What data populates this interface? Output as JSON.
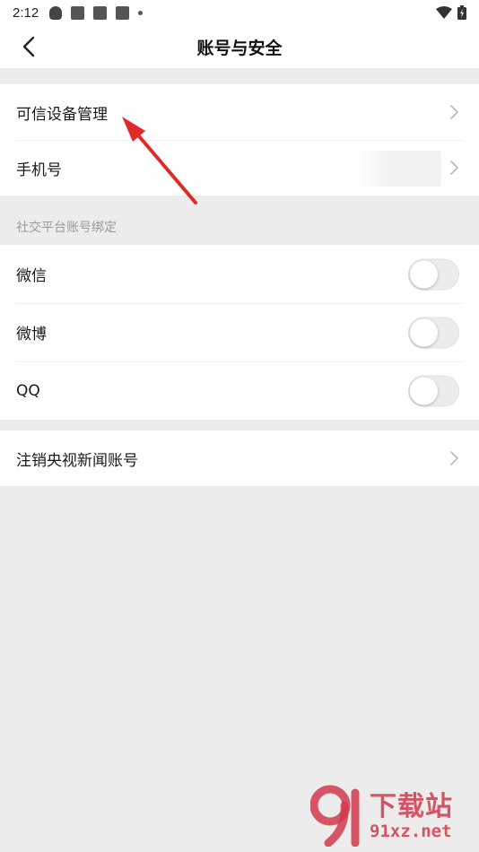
{
  "status_bar": {
    "time": "2:12"
  },
  "header": {
    "title": "账号与安全",
    "back_icon": "chevron-left-icon"
  },
  "account_group": {
    "items": [
      {
        "label": "可信设备管理"
      },
      {
        "label": "手机号"
      }
    ]
  },
  "social_section": {
    "title": "社交平台账号绑定",
    "items": [
      {
        "label": "微信",
        "enabled": false
      },
      {
        "label": "微博",
        "enabled": false
      },
      {
        "label": "QQ",
        "enabled": false
      }
    ]
  },
  "deregister_group": {
    "label": "注销央视新闻账号"
  },
  "colors": {
    "background": "#ececec",
    "annotation_arrow": "#e02a2a",
    "watermark": "#d23a4d"
  },
  "watermark": {
    "title": "下载站",
    "url": "91xz.net"
  }
}
